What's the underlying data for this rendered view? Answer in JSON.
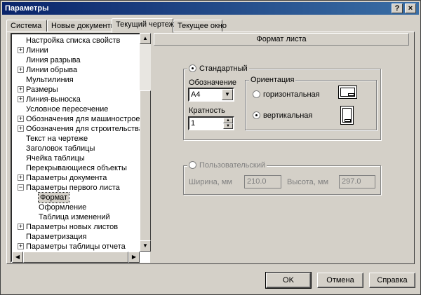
{
  "window": {
    "title": "Параметры",
    "help_label": "?",
    "close_label": "×"
  },
  "tabs": [
    {
      "label": "Система"
    },
    {
      "label": "Новые документы"
    },
    {
      "label": "Текущий чертеж"
    },
    {
      "label": "Текущее окно"
    }
  ],
  "tree": {
    "items": [
      {
        "label": "Настройка списка свойств"
      },
      {
        "label": "Линии"
      },
      {
        "label": "Линия разрыва"
      },
      {
        "label": "Линии обрыва"
      },
      {
        "label": "Мультилиния"
      },
      {
        "label": "Размеры"
      },
      {
        "label": "Линия-выноска"
      },
      {
        "label": "Условное пересечение"
      },
      {
        "label": "Обозначения для машиностроения"
      },
      {
        "label": "Обозначения для строительства"
      },
      {
        "label": "Текст на чертеже"
      },
      {
        "label": "Заголовок таблицы"
      },
      {
        "label": "Ячейка таблицы"
      },
      {
        "label": "Перекрывающиеся объекты"
      },
      {
        "label": "Параметры документа"
      },
      {
        "label": "Параметры первого листа"
      },
      {
        "label": "Формат"
      },
      {
        "label": "Оформление"
      },
      {
        "label": "Таблица изменений"
      },
      {
        "label": "Параметры новых листов"
      },
      {
        "label": "Параметризация"
      },
      {
        "label": "Параметры таблицы отчета"
      }
    ]
  },
  "panel": {
    "header": "Формат листа",
    "standard": {
      "label": "Стандартный",
      "designation_label": "Обозначение",
      "designation_value": "А4",
      "multiplicity_label": "Кратность",
      "multiplicity_value": "1",
      "orientation": {
        "label": "Ориентация",
        "horizontal_label": "горизонтальная",
        "vertical_label": "вертикальная"
      }
    },
    "custom": {
      "label": "Пользовательский",
      "width_label": "Ширина, мм",
      "width_value": "210.0",
      "height_label": "Высота, мм",
      "height_value": "297.0"
    }
  },
  "buttons": {
    "ok": "OK",
    "cancel": "Отмена",
    "help": "Справка"
  }
}
